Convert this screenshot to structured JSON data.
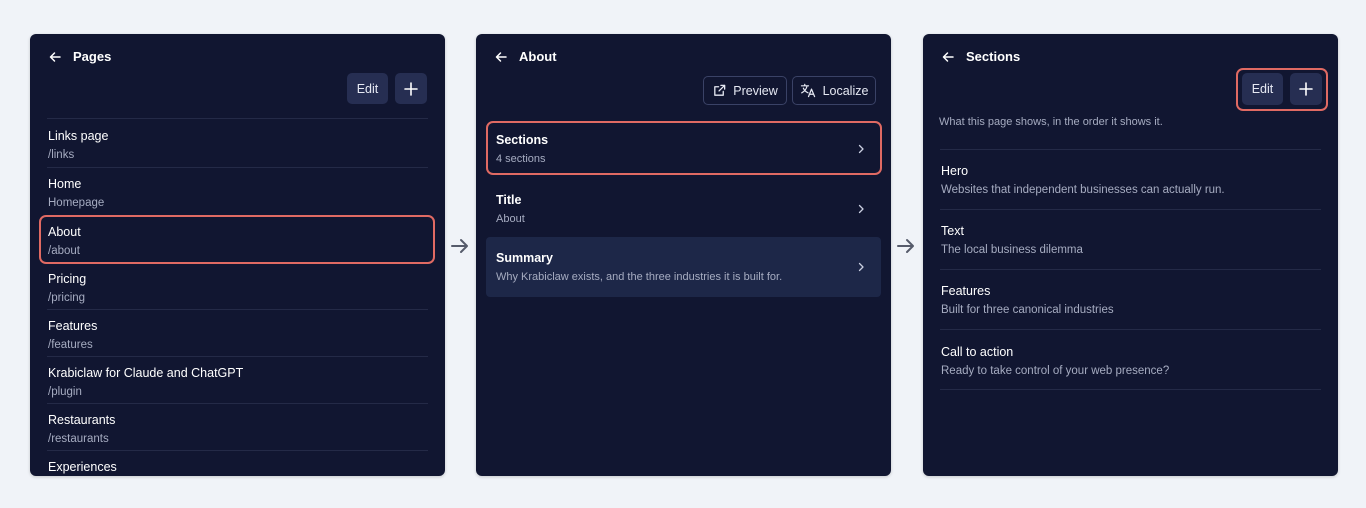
{
  "colors": {
    "background": "#f0f3f8",
    "panel": "#111631",
    "accent_outline": "#e06a63",
    "button_fill": "#262e52",
    "active_row": "#1d2748"
  },
  "pages_panel": {
    "title": "Pages",
    "edit_label": "Edit",
    "add_icon": "plus-icon",
    "back_icon": "arrow-left-icon",
    "items": [
      {
        "title": "Links page",
        "path": "/links"
      },
      {
        "title": "Home",
        "path": "Homepage"
      },
      {
        "title": "About",
        "path": "/about"
      },
      {
        "title": "Pricing",
        "path": "/pricing"
      },
      {
        "title": "Features",
        "path": "/features"
      },
      {
        "title": "Krabiclaw for Claude and ChatGPT",
        "path": "/plugin"
      },
      {
        "title": "Restaurants",
        "path": "/restaurants"
      },
      {
        "title": "Experiences",
        "path": ""
      }
    ]
  },
  "about_panel": {
    "title": "About",
    "preview_label": "Preview",
    "localize_label": "Localize",
    "preview_icon": "external-link-icon",
    "localize_icon": "translate-icon",
    "items": [
      {
        "title": "Sections",
        "subtitle": "4 sections"
      },
      {
        "title": "Title",
        "subtitle": "About"
      },
      {
        "title": "Summary",
        "subtitle": "Why Krabiclaw exists, and the three industries it is built for."
      }
    ]
  },
  "sections_panel": {
    "title": "Sections",
    "edit_label": "Edit",
    "description": "What this page shows, in the order it shows it.",
    "items": [
      {
        "title": "Hero",
        "subtitle": "Websites that independent businesses can actually run."
      },
      {
        "title": "Text",
        "subtitle": "The local business dilemma"
      },
      {
        "title": "Features",
        "subtitle": "Built for three canonical industries"
      },
      {
        "title": "Call to action",
        "subtitle": "Ready to take control of your web presence?"
      }
    ]
  },
  "flow_icon": "arrow-right-icon"
}
